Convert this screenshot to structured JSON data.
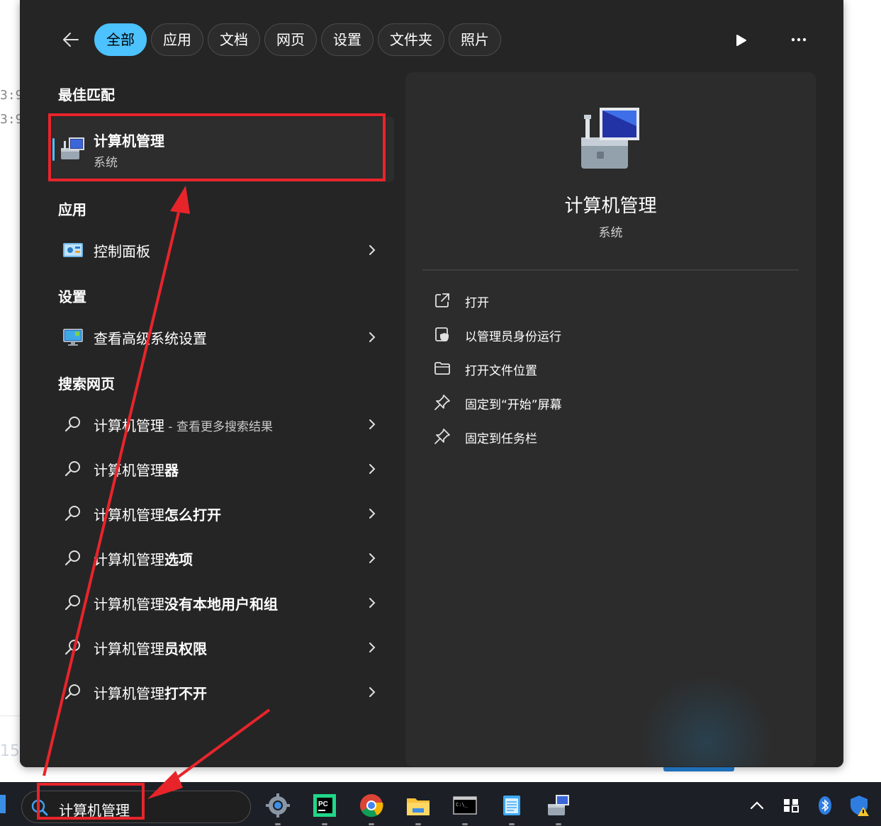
{
  "background": {
    "left_lines": [
      "3:9",
      "3:9"
    ],
    "left_number": "15"
  },
  "filters": {
    "chips": [
      {
        "label": "全部",
        "active": true
      },
      {
        "label": "应用",
        "active": false
      },
      {
        "label": "文档",
        "active": false
      },
      {
        "label": "网页",
        "active": false
      },
      {
        "label": "设置",
        "active": false
      },
      {
        "label": "文件夹",
        "active": false
      },
      {
        "label": "照片",
        "active": false
      }
    ]
  },
  "sections": {
    "best_match": "最佳匹配",
    "apps": "应用",
    "settings": "设置",
    "web": "搜索网页"
  },
  "best_match": {
    "title": "计算机管理",
    "subtitle": "系统"
  },
  "apps": [
    {
      "label": "控制面板"
    }
  ],
  "settings_items": [
    {
      "label": "查看高级系统设置"
    }
  ],
  "web_results": [
    {
      "prefix": "计算机管理",
      "bold": "",
      "hint": " - 查看更多搜索结果"
    },
    {
      "prefix": "计算机管理",
      "bold": "器",
      "hint": ""
    },
    {
      "prefix": "计算机管理",
      "bold": "怎么打开",
      "hint": ""
    },
    {
      "prefix": "计算机管理",
      "bold": "选项",
      "hint": ""
    },
    {
      "prefix": "计算机管理",
      "bold": "没有本地用户和组",
      "hint": ""
    },
    {
      "prefix": "计算机管理",
      "bold": "员权限",
      "hint": ""
    },
    {
      "prefix": "计算机管理",
      "bold": "打不开",
      "hint": ""
    }
  ],
  "detail": {
    "title": "计算机管理",
    "subtitle": "系统",
    "actions": [
      {
        "label": "打开",
        "icon": "open-external-icon"
      },
      {
        "label": "以管理员身份运行",
        "icon": "shield-admin-icon"
      },
      {
        "label": "打开文件位置",
        "icon": "folder-icon"
      },
      {
        "label": "固定到“开始”屏幕",
        "icon": "pin-icon"
      },
      {
        "label": "固定到任务栏",
        "icon": "pin-icon"
      }
    ]
  },
  "taskbar": {
    "search_text": "计算机管理",
    "apps": [
      "settings-gear-icon",
      "pycharm-icon",
      "chrome-icon",
      "file-explorer-icon",
      "terminal-icon",
      "notepad-icon",
      "computer-management-icon"
    ],
    "tray": [
      "chevron-up-icon",
      "taskview-icon",
      "bluetooth-icon",
      "security-warning-icon"
    ]
  },
  "colors": {
    "accent": "#4cc2ff",
    "panel": "#252525",
    "annotation_red": "#e8242b"
  }
}
